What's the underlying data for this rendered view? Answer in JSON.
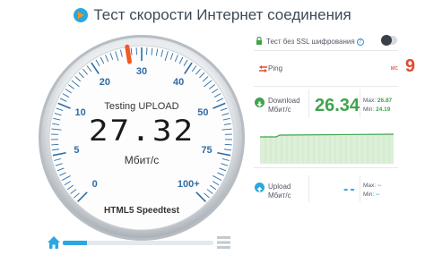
{
  "header": {
    "title": "Тест скорости Интернет соединения",
    "logo_icon": "play-circle-icon"
  },
  "gauge": {
    "scale_labels": [
      "0",
      "5",
      "10",
      "20",
      "30",
      "40",
      "50",
      "75",
      "100+"
    ],
    "status": "Testing UPLOAD",
    "value": "27.32",
    "unit": "Мбит/с",
    "brand": "HTML5 Speedtest",
    "needle_value": 27.32
  },
  "controls": {
    "progress": 0.16
  },
  "panel": {
    "ssl": {
      "label": "Тест без SSL шифрования",
      "help": "?",
      "enabled": false
    },
    "ping": {
      "label": "Ping",
      "value": "9",
      "unit": "мс"
    },
    "download": {
      "label": "Download",
      "unit": "Мбит/с",
      "value": "26.34",
      "max_label": "Max:",
      "max_value": "26.87",
      "min_label": "Min:",
      "min_value": "24.19"
    },
    "upload": {
      "label": "Upload",
      "unit": "Мбит/с",
      "value": "--",
      "max_label": "Max:",
      "max_value": "--",
      "min_label": "Min:",
      "min_value": "--"
    }
  },
  "colors": {
    "accent": "#2aa8e0",
    "ping": "#e04b2b",
    "download": "#3fa34d",
    "scale": "#2e6da4"
  }
}
